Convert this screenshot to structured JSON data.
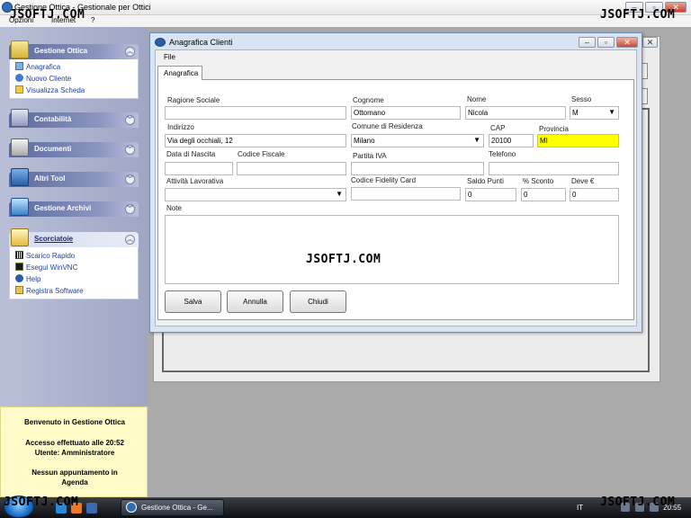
{
  "main_window": {
    "title": "Gestione Ottica - Gestionale per Ottici",
    "menu": [
      "Opzioni",
      "Internet",
      "?"
    ],
    "watermark": "JSOFTJ.COM"
  },
  "sidebar": {
    "panels": [
      {
        "title": "Gestione Ottica",
        "expanded": true,
        "items": [
          "Anagrafica",
          "Nuovo Cliente",
          "Visualizza Scheda"
        ]
      },
      {
        "title": "Contabilità",
        "expanded": false
      },
      {
        "title": "Documenti",
        "expanded": false
      },
      {
        "title": "Altri Tool",
        "expanded": false
      },
      {
        "title": "Gestione Archivi",
        "expanded": false
      },
      {
        "title": "Scorciatoie",
        "expanded": true,
        "items": [
          "Scarico Rapido",
          "Esegui WinVNC",
          "Help",
          "Registra Software"
        ]
      }
    ]
  },
  "welcome": {
    "line1": "Benvenuto in Gestione Ottica",
    "line2": "Accesso effettuato alle 20:52",
    "line3": "Utente: Amministratore",
    "line4": "Nessun appuntamento in",
    "line5": "Agenda"
  },
  "dialog": {
    "title": "Anagrafica Clienti",
    "menu_file": "File",
    "tab": "Anagrafica",
    "fields": {
      "ragione_sociale": {
        "label": "Ragione Sociale",
        "value": ""
      },
      "cognome": {
        "label": "Cognome",
        "value": "Ottomano"
      },
      "nome": {
        "label": "Nome",
        "value": "Nicola"
      },
      "sesso": {
        "label": "Sesso",
        "value": "M"
      },
      "indirizzo": {
        "label": "Indirizzo",
        "value": "Via degli occhiali, 12"
      },
      "comune": {
        "label": "Comune di Residenza",
        "value": "Milano"
      },
      "cap": {
        "label": "CAP",
        "value": "20100"
      },
      "provincia": {
        "label": "Provincia",
        "value": "MI"
      },
      "data_nascita": {
        "label": "Data di Nascita",
        "value": ""
      },
      "codice_fiscale": {
        "label": "Codice Fiscale",
        "value": ""
      },
      "partita_iva": {
        "label": "Partita IVA",
        "value": ""
      },
      "telefono": {
        "label": "Telefono",
        "value": ""
      },
      "attivita": {
        "label": "Attività Lavorativa",
        "value": ""
      },
      "fidelity": {
        "label": "Codice Fidelity Card",
        "value": ""
      },
      "saldo_punti": {
        "label": "Saldo Punti",
        "value": "0"
      },
      "sconto": {
        "label": "% Sconto",
        "value": "0"
      },
      "deve": {
        "label": "Deve €",
        "value": "0"
      },
      "note": {
        "label": "Note",
        "value": ""
      }
    },
    "buttons": {
      "save": "Salva",
      "cancel": "Annulla",
      "close": "Chiudi"
    },
    "watermark": "JSOFTJ.COM"
  },
  "taskbar": {
    "task_label": "Gestione Ottica - Ge...",
    "language": "IT",
    "clock": "20:55",
    "watermark": "JSOFTJ.COM"
  },
  "colors": {
    "accent": "#2f6db5",
    "highlight_field": "#ffff00",
    "panel_header": "#5a6aa0"
  }
}
